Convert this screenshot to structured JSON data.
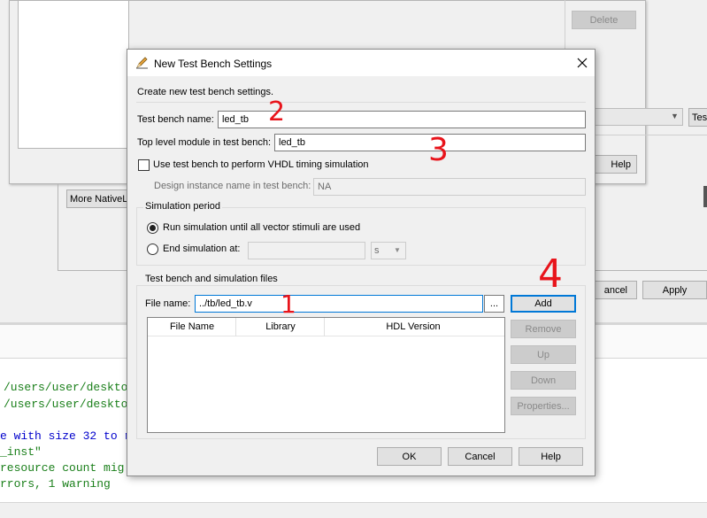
{
  "background": {
    "delete_label": "Delete",
    "help_label": "Help",
    "cancel_label": "ancel",
    "apply_label": "Apply",
    "native_link_button": "More NativeLi",
    "right_button_fragment": "Tes",
    "console_lines": [
      "/users/user/deskto",
      "/users/user/deskto",
      "e with size 32 to r",
      "_inst\"",
      " resource count mig",
      "rrors, 1 warning"
    ]
  },
  "dialog": {
    "title": "New Test Bench Settings",
    "intro": "Create new test bench settings.",
    "tb_name_label": "Test bench name:",
    "tb_name_value": "led_tb",
    "top_module_label": "Top level module in test bench:",
    "top_module_value": "led_tb",
    "vhdl_checkbox_label": "Use test bench to perform VHDL timing simulation",
    "design_instance_label": "Design instance name in test bench:",
    "design_instance_value": "NA",
    "sim_period": {
      "title": "Simulation period",
      "option1": "Run simulation until all vector stimuli are used",
      "option2": "End simulation at:",
      "unit": "s"
    },
    "files": {
      "title": "Test bench and simulation files",
      "file_name_label": "File name:",
      "file_name_value": "../tb/led_tb.v",
      "browse_label": "...",
      "add_label": "Add",
      "remove_label": "Remove",
      "up_label": "Up",
      "down_label": "Down",
      "properties_label": "Properties...",
      "columns": [
        "File Name",
        "Library",
        "HDL Version"
      ]
    },
    "ok_label": "OK",
    "cancel_label": "Cancel",
    "help_label": "Help"
  },
  "annotations": {
    "num1": "1",
    "num2": "2",
    "num3": "3",
    "num4": "4"
  },
  "colors": {
    "annotation": "#e8141b",
    "console_blue": "#0000cc",
    "console_green": "#1a7f1a",
    "focus": "#0078d7"
  }
}
